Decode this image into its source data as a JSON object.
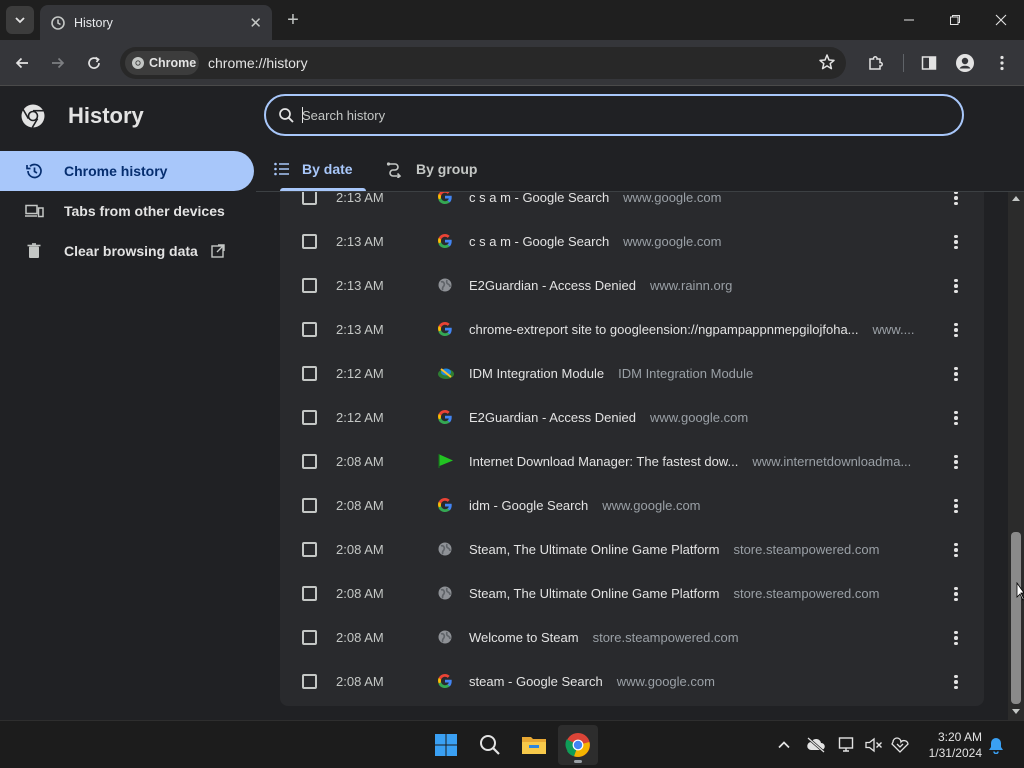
{
  "browser": {
    "tab_title": "History",
    "chip_label": "Chrome",
    "url": "chrome://history"
  },
  "sidebar": {
    "title": "History",
    "items": [
      {
        "label": "Chrome history",
        "icon": "history-icon"
      },
      {
        "label": "Tabs from other devices",
        "icon": "devices-icon"
      },
      {
        "label": "Clear browsing data",
        "icon": "trash-icon"
      }
    ]
  },
  "search": {
    "placeholder": "Search history"
  },
  "tabs": [
    {
      "label": "By date"
    },
    {
      "label": "By group"
    }
  ],
  "history": [
    {
      "time": "2:13 AM",
      "title": "c s a m - Google Search",
      "domain": "www.google.com",
      "favicon": "google-icon"
    },
    {
      "time": "2:13 AM",
      "title": "c s a m - Google Search",
      "domain": "www.google.com",
      "favicon": "google-icon"
    },
    {
      "time": "2:13 AM",
      "title": "E2Guardian - Access Denied",
      "domain": "www.rainn.org",
      "favicon": "globe-icon"
    },
    {
      "time": "2:13 AM",
      "title": "chrome-extreport site to googleension://ngpampappnmepgilojfoha...",
      "domain": "www....",
      "favicon": "google-icon"
    },
    {
      "time": "2:12 AM",
      "title": "IDM Integration Module",
      "domain": "IDM Integration Module",
      "favicon": "idm-icon"
    },
    {
      "time": "2:12 AM",
      "title": "E2Guardian - Access Denied",
      "domain": "www.google.com",
      "favicon": "google-icon"
    },
    {
      "time": "2:08 AM",
      "title": "Internet Download Manager: The fastest dow...",
      "domain": "www.internetdownloadma...",
      "favicon": "idm-flag-icon"
    },
    {
      "time": "2:08 AM",
      "title": "idm - Google Search",
      "domain": "www.google.com",
      "favicon": "google-icon"
    },
    {
      "time": "2:08 AM",
      "title": "Steam, The Ultimate Online Game Platform",
      "domain": "store.steampowered.com",
      "favicon": "globe-icon"
    },
    {
      "time": "2:08 AM",
      "title": "Steam, The Ultimate Online Game Platform",
      "domain": "store.steampowered.com",
      "favicon": "globe-icon"
    },
    {
      "time": "2:08 AM",
      "title": "Welcome to Steam",
      "domain": "store.steampowered.com",
      "favicon": "globe-icon"
    },
    {
      "time": "2:08 AM",
      "title": "steam - Google Search",
      "domain": "www.google.com",
      "favicon": "google-icon"
    }
  ],
  "taskbar": {
    "time": "3:20 AM",
    "date": "1/31/2024"
  },
  "colors": {
    "accent": "#a8c7fa",
    "background": "#202124",
    "card": "#292a2d"
  }
}
